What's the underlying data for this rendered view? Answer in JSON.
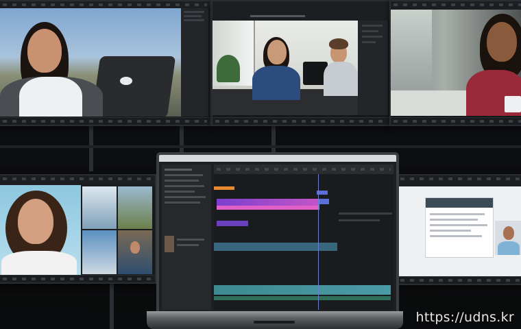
{
  "watermark": {
    "text": "https://udns.kr"
  },
  "colors": {
    "clip_purple": "#a44fcf",
    "clip_purple_dark": "#6a3fc0",
    "clip_orange": "#e8892f",
    "clip_teal": "#3f8f9a",
    "clip_blue": "#5b6fd8",
    "studio_bg": "#0b0c0e"
  },
  "screens": [
    {
      "id": "top-left-video",
      "subject": "woman-smiling"
    },
    {
      "id": "top-center-video",
      "subject": "two-people-office"
    },
    {
      "id": "top-right-video",
      "subject": "woman-red-jacket"
    },
    {
      "id": "bottom-left-video",
      "subject": "woman-curly-hair"
    },
    {
      "id": "laptop-editor",
      "subject": "video-timeline"
    },
    {
      "id": "bottom-right-browser",
      "subject": "web-page"
    }
  ]
}
